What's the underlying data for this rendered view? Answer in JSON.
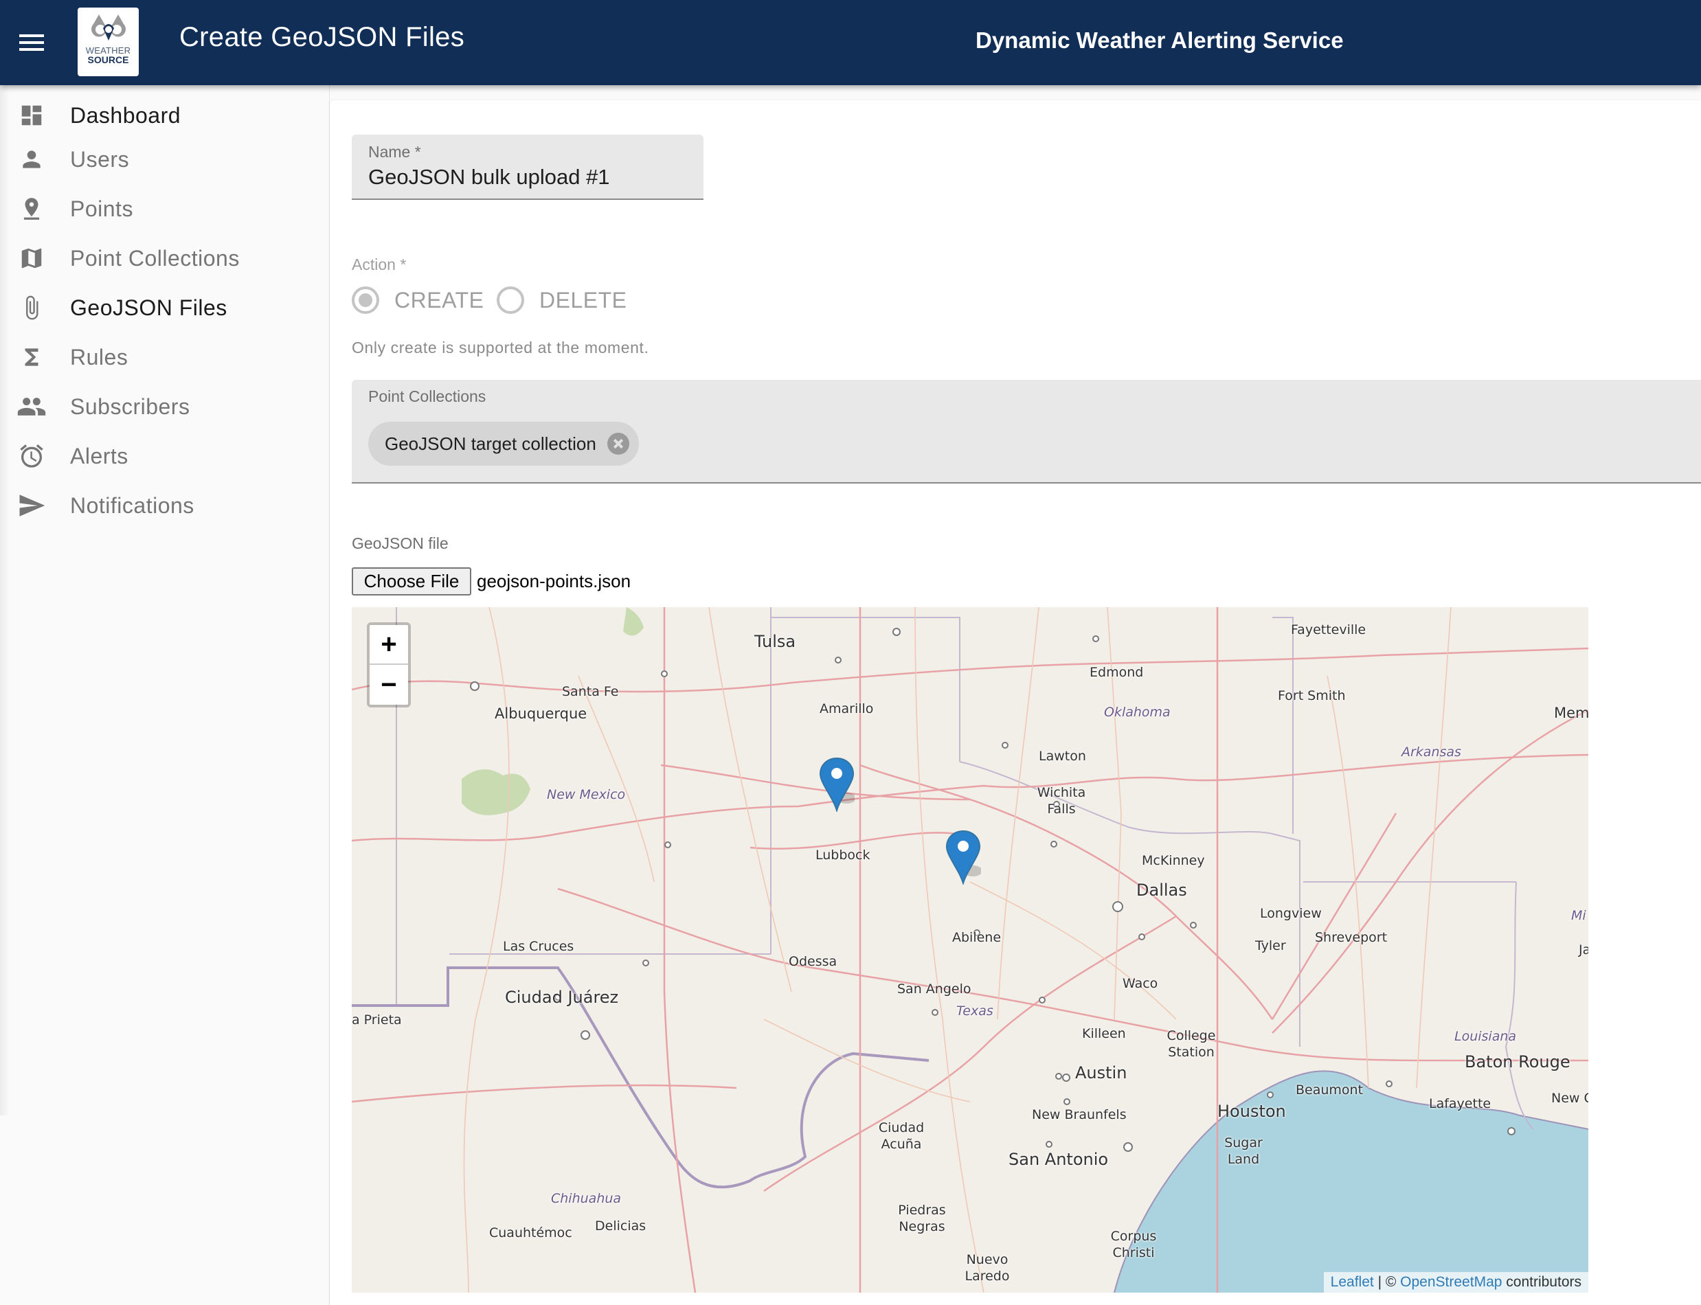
{
  "app_bar": {
    "menu_icon": "hamburger-menu-icon",
    "logo_line1": "WEATHER",
    "logo_line2": "SOURCE",
    "page_title": "Create GeoJSON Files",
    "service_title": "Dynamic Weather Alerting Service",
    "color": "#112e56"
  },
  "sidebar": {
    "items": [
      {
        "label": "Dashboard",
        "icon": "dashboard-icon"
      },
      {
        "label": "Users",
        "icon": "person-icon"
      },
      {
        "label": "Points",
        "icon": "pin-drop-icon"
      },
      {
        "label": "Point Collections",
        "icon": "map-icon"
      },
      {
        "label": "GeoJSON Files",
        "icon": "paperclip-icon",
        "active": true
      },
      {
        "label": "Rules",
        "icon": "sigma-icon"
      },
      {
        "label": "Subscribers",
        "icon": "people-icon"
      },
      {
        "label": "Alerts",
        "icon": "alarm-clock-icon"
      },
      {
        "label": "Notifications",
        "icon": "send-icon"
      }
    ]
  },
  "form": {
    "name_label": "Name *",
    "name_value": "GeoJSON bulk upload #1",
    "action_label": "Action *",
    "action_options": [
      {
        "label": "CREATE",
        "selected": true
      },
      {
        "label": "DELETE",
        "selected": false
      }
    ],
    "action_helper": "Only create is supported at the moment.",
    "point_collections_label": "Point Collections",
    "point_collections_chips": [
      "GeoJSON target collection"
    ],
    "file_label": "GeoJSON file",
    "file_button": "Choose File",
    "file_name": "geojson-points.json"
  },
  "map": {
    "zoom_in": "+",
    "zoom_out": "−",
    "markers": 2,
    "cities": [
      "Tulsa",
      "Fayetteville",
      "Edmond",
      "Fort Smith",
      "Santa Fe",
      "Albuquerque",
      "Amarillo",
      "Mem",
      "Lawton",
      "Wichita Falls",
      "New Mexico",
      "Oklahoma",
      "Arkansas",
      "McKinney",
      "Lubbock",
      "Dallas",
      "Longview",
      "Abilene",
      "Shreveport",
      "Tyler",
      "Las Cruces",
      "Odessa",
      "Jackso",
      "Ciudad Juárez",
      "San Angelo",
      "Texas",
      "Waco",
      "a Prieta",
      "Killeen",
      "College Station",
      "Louisiana",
      "Austin",
      "Baton Rouge",
      "Beaumont",
      "Lafayette",
      "New Or",
      "Houston",
      "New Braunfels",
      "Ciudad Acuña",
      "San Antonio",
      "Sugar Land",
      "Chihuahua",
      "Cuauhtémoc",
      "Delicias",
      "Piedras Negras",
      "Corpus Christi",
      "Nuevo Laredo",
      "Mi"
    ],
    "attribution": {
      "leaflet": "Leaflet",
      "separator": " | © ",
      "osm": "OpenStreetMap",
      "suffix": " contributors"
    }
  }
}
